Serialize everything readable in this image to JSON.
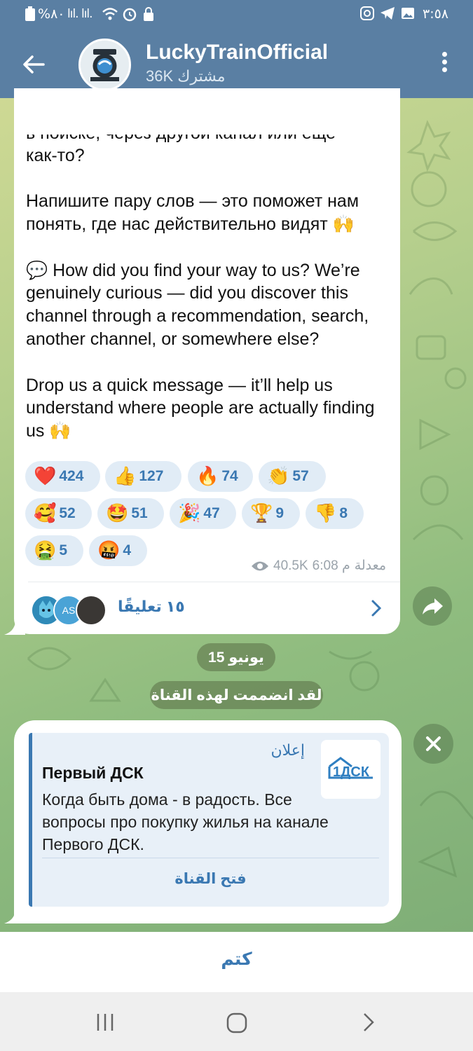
{
  "status_bar": {
    "battery_text": "%٨٠",
    "signal_text": "lıl. lıl.",
    "time": "٣:٥٨"
  },
  "header": {
    "title": "LuckyTrainOfficial",
    "subtitle": "36K مشترك",
    "back_icon": "arrow-left-icon",
    "menu_icon": "more-vertical-icon"
  },
  "message": {
    "partial_line": "в поиске, через другой канал или еще",
    "paragraphs": [
      "как-то?",
      "",
      "Напишите пару слов — это поможет нам понять, где нас действительно видят 🙌",
      "",
      "💬 How did you find your way to us? We’re genuinely curious — did you discover this channel through a recommendation, search, another channel, or somewhere else?",
      "",
      "Drop us a quick message — it’ll help us understand where people are actually finding us 🙌"
    ],
    "reactions": [
      {
        "emoji": "❤️",
        "count": "424"
      },
      {
        "emoji": "👍",
        "count": "127"
      },
      {
        "emoji": "🔥",
        "count": "74"
      },
      {
        "emoji": "👏",
        "count": "57"
      },
      {
        "emoji": "🥰",
        "count": "52"
      },
      {
        "emoji": "🤩",
        "count": "51"
      },
      {
        "emoji": "🎉",
        "count": "47"
      },
      {
        "emoji": "🏆",
        "count": "9"
      },
      {
        "emoji": "👎",
        "count": "8"
      },
      {
        "emoji": "🤮",
        "count": "5"
      },
      {
        "emoji": "🤬",
        "count": "4"
      }
    ],
    "meta": {
      "views": "40.5K",
      "time": "6:08 م",
      "edited": "معدلة"
    },
    "comments": {
      "label": "١٥ تعليقًا",
      "avatar_initials": "AS"
    }
  },
  "service": {
    "date": "15 يونيو",
    "joined": "لقد انضممت لهذه القناة"
  },
  "ad": {
    "tag": "إعلان",
    "title": "Первый ДСК",
    "text": "Когда быть дома - в радость. Все вопросы про покупку жилья на канале Первого ДСК.",
    "logo_text": "1ДСК",
    "open_label": "فتح القناة"
  },
  "bottom": {
    "mute_label": "كتم"
  },
  "colors": {
    "header": "#5a7fa3",
    "accent": "#3a78b2",
    "reaction_bg": "#e1ecf6"
  }
}
